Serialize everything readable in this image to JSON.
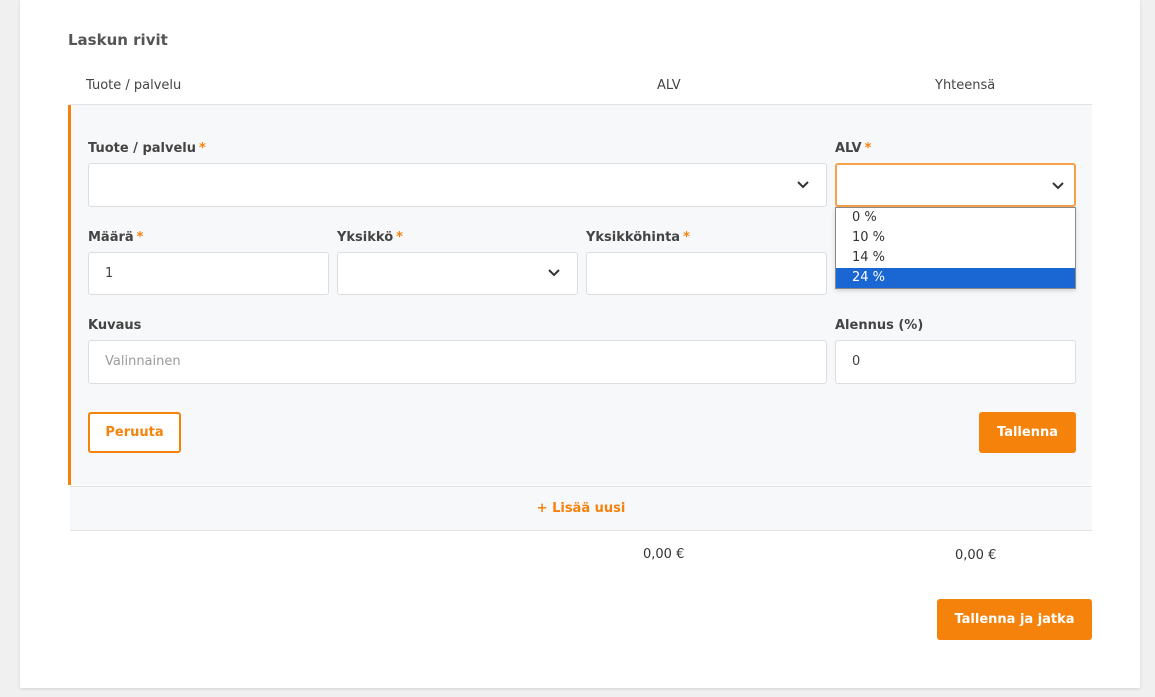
{
  "section": {
    "title": "Laskun rivit"
  },
  "columns": {
    "product": "Tuote / palvelu",
    "vat": "ALV",
    "total": "Yhteensä"
  },
  "editor": {
    "product_label": "Tuote / palvelu",
    "vat_label": "ALV",
    "quantity_label": "Määrä",
    "quantity_value": "1",
    "unit_label": "Yksikkö",
    "unit_price_label": "Yksikköhinta",
    "description_label": "Kuvaus",
    "description_placeholder": "Valinnainen",
    "discount_label": "Alennus (%)",
    "discount_value": "0",
    "required_mark": "*",
    "vat_options": [
      "0 %",
      "10 %",
      "14 %",
      "24 %"
    ],
    "vat_highlighted": "24 %",
    "cancel_label": "Peruuta",
    "save_label": "Tallenna"
  },
  "add_new_label": "+ Lisää uusi",
  "totals": {
    "vat_total": "0,00 €",
    "grand_total": "0,00 €"
  },
  "save_continue_label": "Tallenna ja jatka",
  "colors": {
    "accent": "#f5820b",
    "highlight": "#1a66d2"
  }
}
